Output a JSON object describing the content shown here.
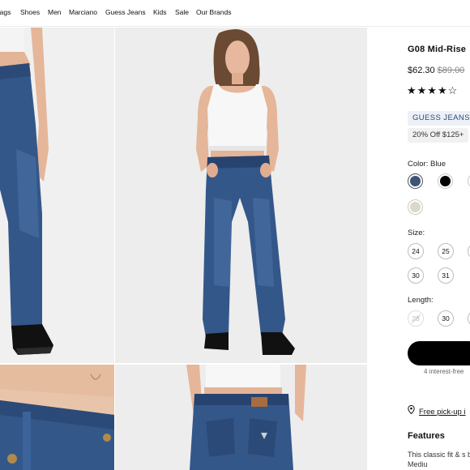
{
  "nav": {
    "items": [
      "Bags",
      "Shoes",
      "Men",
      "Marciano",
      "Guess Jeans",
      "Kids",
      "Sale",
      "Our Brands"
    ]
  },
  "product": {
    "name": "G08 Mid-Rise",
    "price": "$62.30",
    "original_price": "$89.00",
    "rating_stars": "★★★★☆",
    "rating_value": 4,
    "brand_tag": "GUESS JEANS",
    "promo": "20% Off $125+",
    "color_label": "Color: Blue",
    "colors": [
      {
        "name": "Blue",
        "hex": "#3d5478",
        "selected": true
      },
      {
        "name": "Black",
        "hex": "#000000",
        "selected": false
      },
      {
        "name": "Ecru",
        "hex": "#ddd7c8",
        "selected": false
      }
    ],
    "size_label": "Size:",
    "sizes_row1": [
      "24",
      "25"
    ],
    "sizes_row2": [
      "30",
      "31"
    ],
    "length_label": "Length:",
    "lengths": [
      "28",
      "30"
    ],
    "interest_text": "4 interest-free",
    "pickup_text": "Free pick-up i",
    "features_title": "Features",
    "features_body": "This classic fit & s be lived in. Mediu"
  },
  "colors": {
    "denim": "#34578a",
    "denim_dark": "#274370",
    "denim_light": "#4c74a8",
    "skin": "#e7b89d",
    "hair": "#6a4a32",
    "shoe": "#111111",
    "cta": "#000000"
  }
}
